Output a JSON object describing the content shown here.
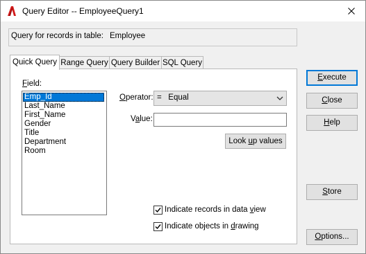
{
  "window": {
    "title": "Query Editor -- EmployeeQuery1",
    "close_glyph": "✕"
  },
  "info": {
    "label": "Query for records in table:",
    "table": "Employee"
  },
  "tabs": [
    {
      "label": "Quick Query",
      "active": true
    },
    {
      "label": "Range Query",
      "active": false
    },
    {
      "label": "Query Builder",
      "active": false
    },
    {
      "label": "SQL Query",
      "active": false
    }
  ],
  "field": {
    "label_mnemonic": "F",
    "label_rest": "ield:",
    "items": [
      "Emp_Id",
      "Last_Name",
      "First_Name",
      "Gender",
      "Title",
      "Department",
      "Room"
    ],
    "selected_index": 0
  },
  "operator": {
    "label_mnemonic": "O",
    "label_rest": "perator:",
    "selected": "=   Equal"
  },
  "value": {
    "label_pre": "V",
    "label_mnemonic": "a",
    "label_rest": "lue:",
    "current": ""
  },
  "lookup_button": {
    "pre": "Look ",
    "mnemonic": "u",
    "rest": "p values"
  },
  "checkboxes": {
    "indicate_records": {
      "label_pre": "Indicate records in data ",
      "mnemonic": "v",
      "label_rest": "iew",
      "checked": true
    },
    "indicate_objects": {
      "label_pre": "Indicate objects in ",
      "mnemonic": "d",
      "label_rest": "rawing",
      "checked": true
    }
  },
  "buttons": {
    "execute": {
      "mnemonic": "E",
      "rest": "xecute"
    },
    "close": {
      "mnemonic": "C",
      "rest": "lose"
    },
    "help": {
      "mnemonic": "H",
      "rest": "elp"
    },
    "store": {
      "mnemonic": "S",
      "rest": "tore"
    },
    "options": {
      "mnemonic": "O",
      "rest": "ptions..."
    }
  },
  "colors": {
    "selection": "#0078d7",
    "app_icon": "#d21a1a"
  }
}
